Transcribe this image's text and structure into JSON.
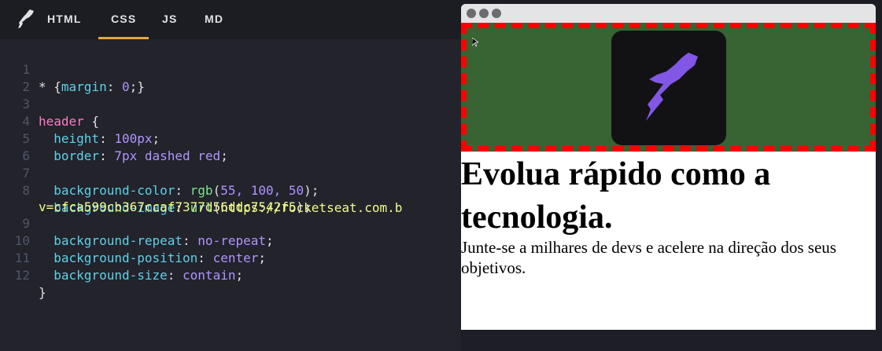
{
  "tabs": [
    {
      "label": "HTML",
      "active": false
    },
    {
      "label": "CSS",
      "active": true
    },
    {
      "label": "JS",
      "active": false
    },
    {
      "label": "MD",
      "active": false
    }
  ],
  "editor": {
    "line_numbers": [
      "1",
      "2",
      "3",
      "4",
      "5",
      "6",
      "7",
      "8",
      "",
      "9",
      "10",
      "11",
      "12"
    ],
    "lines": {
      "l1": {
        "sel": "*",
        "rest1": " {",
        "prop": "margin",
        "colon": ": ",
        "val": "0",
        "end": ";}"
      },
      "l3": {
        "sel": "header",
        "rest": " {"
      },
      "l4": {
        "prop": "height",
        "colon": ": ",
        "val": "100px",
        "end": ";"
      },
      "l5": {
        "prop": "border",
        "colon": ": ",
        "val": "7px dashed red",
        "end": ";"
      },
      "l7": {
        "prop": "background-color",
        "colon": ": ",
        "fn": "rgb",
        "open": "(",
        "val": "55, 100, 50",
        "end": ");"
      },
      "l8": {
        "prop": "background-image",
        "colon": ": ",
        "fn": "url",
        "open": "(",
        "str": "https://rocketseat.com.b"
      },
      "l8b": {
        "str": "v=cfca599cb367ccaf7377d56ddc7542f5",
        "end": ");"
      },
      "l9": {
        "prop": "background-repeat",
        "colon": ": ",
        "val": "no-repeat",
        "end": ";"
      },
      "l10": {
        "prop": "background-position",
        "colon": ": ",
        "val": "center",
        "end": ";"
      },
      "l11": {
        "prop": "background-size",
        "colon": ": ",
        "val": "contain",
        "end": ";"
      },
      "l12": {
        "end": "}"
      }
    }
  },
  "preview": {
    "heading": "Evolua rápido como a tecnologia.",
    "paragraph": "Junte-se a milhares de devs e acelere na direção dos seus objetivos.",
    "header_bg": "#376432",
    "header_border": "red"
  },
  "colors": {
    "accent": "#e5a639",
    "logo_purple": "#8257e5"
  }
}
